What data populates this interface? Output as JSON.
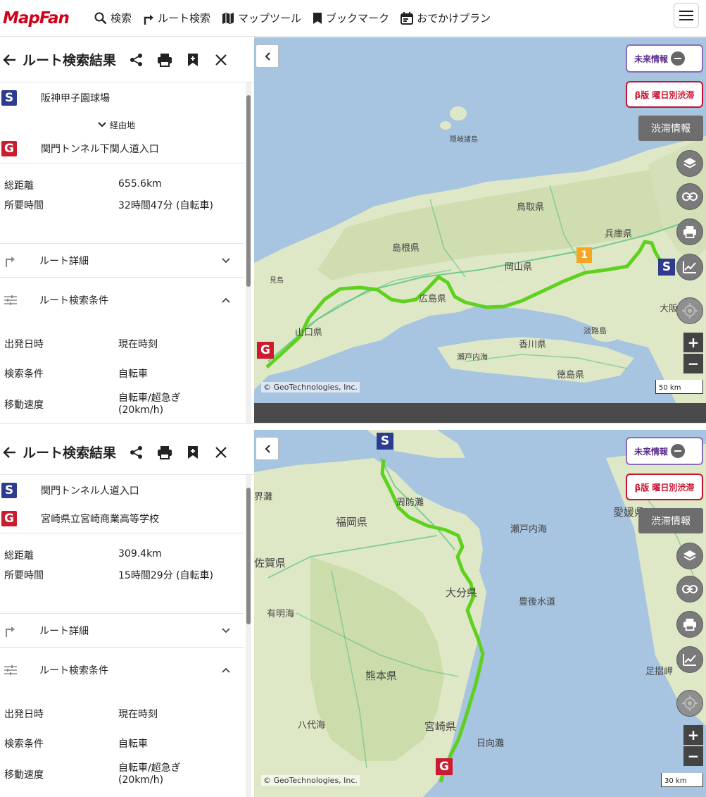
{
  "app": {
    "logo": "MapFan"
  },
  "nav": {
    "items": [
      {
        "label": "検索",
        "icon": "search-icon"
      },
      {
        "label": "ルート検索",
        "icon": "route-icon"
      },
      {
        "label": "マップツール",
        "icon": "map-icon"
      },
      {
        "label": "ブックマーク",
        "icon": "bookmark-icon"
      },
      {
        "label": "おでかけプラン",
        "icon": "calendar-icon"
      }
    ]
  },
  "panel1": {
    "title": "ルート検索結果",
    "start": "阪神甲子園球場",
    "via_label": "経由地",
    "goal": "関門トンネル下関人道入口",
    "distance_label": "総距離",
    "distance": "655.6km",
    "time_label": "所要時間",
    "time": "32時間47分 (自転車)",
    "detail_label": "ルート詳細",
    "conditions_label": "ルート検索条件",
    "depart_label": "出発日時",
    "depart": "現在時刻",
    "cond_label": "検索条件",
    "cond": "自転車",
    "speed_label": "移動速度",
    "speed_line1": "自転車/超急ぎ",
    "speed_line2": "(20km/h)",
    "map": {
      "future": "未来情報",
      "beta": "β版 曜日別渋滞",
      "traffic": "渋滞情報",
      "copyright": "© GeoTechnologies, Inc.",
      "scale": "50 km",
      "start_pin": "S",
      "goal_pin": "G",
      "via_pin": "1",
      "labels": [
        "鳥取県",
        "島根県",
        "岡山県",
        "広島県",
        "山口県",
        "香川県",
        "徳島県",
        "兵庫県",
        "大阪",
        "淡路島",
        "瀬戸内海",
        "隠岐諸島",
        "見島"
      ]
    }
  },
  "panel2": {
    "title": "ルート検索結果",
    "start": "関門トンネル人道入口",
    "goal": "宮崎県立宮崎商業高等学校",
    "distance_label": "総距離",
    "distance": "309.4km",
    "time_label": "所要時間",
    "time": "15時間29分 (自転車)",
    "detail_label": "ルート詳細",
    "conditions_label": "ルート検索条件",
    "depart_label": "出発日時",
    "depart": "現在時刻",
    "cond_label": "検索条件",
    "cond": "自転車",
    "speed_label": "移動速度",
    "speed_line1": "自転車/超急ぎ",
    "speed_line2": "(20km/h)",
    "map": {
      "future": "未来情報",
      "beta": "β版 曜日別渋滞",
      "traffic": "渋滞情報",
      "copyright": "© GeoTechnologies, Inc.",
      "scale": "30 km",
      "start_pin": "S",
      "goal_pin": "G",
      "labels": [
        "福岡県",
        "佐賀県",
        "大分県",
        "熊本県",
        "宮崎県",
        "周防灘",
        "瀬戸内海",
        "有明海",
        "豊後水道",
        "愛媛県",
        "八代海",
        "日向灘",
        "足摺岬",
        "界灘"
      ]
    }
  },
  "colors": {
    "route": "#5ed11e",
    "brand": "#d0021b",
    "start": "#2e3c8f",
    "goal": "#cc1a2e"
  }
}
